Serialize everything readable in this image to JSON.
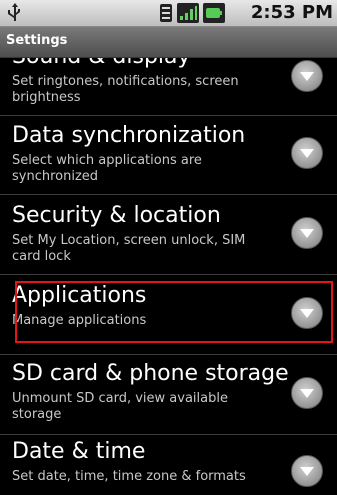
{
  "status_bar": {
    "time": "2:53 PM",
    "icons": [
      "usb-icon",
      "notification-icon",
      "signal-icon",
      "battery-icon"
    ]
  },
  "title_bar": {
    "title": "Settings"
  },
  "settings": {
    "items": [
      {
        "title": "Sound & display",
        "subtitle": "Set ringtones, notifications, screen brightness"
      },
      {
        "title": "Data synchronization",
        "subtitle": "Select which applications are synchronized"
      },
      {
        "title": "Security & location",
        "subtitle": "Set My Location, screen unlock, SIM card lock"
      },
      {
        "title": "Applications",
        "subtitle": "Manage applications"
      },
      {
        "title": "SD card & phone storage",
        "subtitle": "Unmount SD card, view available storage"
      },
      {
        "title": "Date & time",
        "subtitle": "Set date, time, time zone & formats"
      }
    ]
  },
  "colors": {
    "highlight": "#e81414",
    "background": "#000000"
  }
}
